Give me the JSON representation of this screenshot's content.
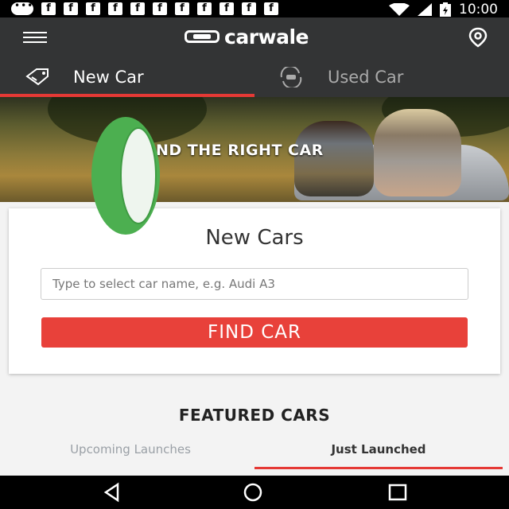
{
  "status_bar": {
    "time": "10:00",
    "notification_icons": [
      "facebook-icon",
      "facebook-icon",
      "facebook-icon",
      "facebook-icon",
      "facebook-icon",
      "facebook-icon",
      "facebook-icon",
      "facebook-icon",
      "facebook-icon",
      "facebook-icon",
      "facebook-icon"
    ],
    "fb_letter": "f"
  },
  "header": {
    "brand": "carwale",
    "tabs": [
      {
        "label": "New Car",
        "icon": "tag-icon",
        "selected": true
      },
      {
        "label": "Used Car",
        "icon": "refresh-car-icon",
        "selected": false
      }
    ]
  },
  "banner": {
    "text": "ND THE RIGHT CAR"
  },
  "new_cars": {
    "title": "New Cars",
    "search_placeholder": "Type to select car name, e.g. Audi A3",
    "search_value": "",
    "button_label": "FIND CAR"
  },
  "featured": {
    "title": "FEATURED CARS",
    "tabs": [
      {
        "label": "Upcoming Launches",
        "selected": false
      },
      {
        "label": "Just Launched",
        "selected": true
      }
    ]
  },
  "colors": {
    "accent": "#e53935",
    "button": "#e8413a",
    "app_bar": "#333435",
    "tire_green": "#4caf50"
  }
}
